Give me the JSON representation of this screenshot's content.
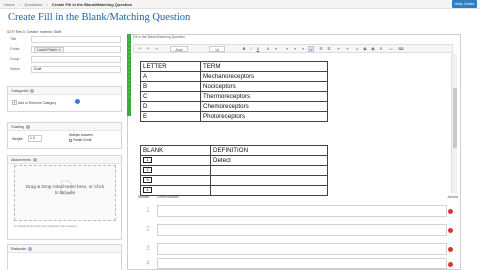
{
  "topbar": {
    "crumbs": [
      "Home",
      "Questions",
      "Create Fill in the Blank/Matching Question"
    ],
    "help_label": "Help Guide"
  },
  "page": {
    "title": "Create Fill in the Blank/Matching Question"
  },
  "meta": {
    "line": "ID 97 Rev 0, Creator: Inventor, Staff"
  },
  "fields": {
    "title_label": "Title",
    "folder_label": "Folder",
    "folder_value": "Lowell Folder",
    "group_label": "Group",
    "status_label": "Status",
    "status_value": "Draft"
  },
  "categories": {
    "header": "Categories",
    "add_label": "Add or Remove Category"
  },
  "grading": {
    "header": "Grading",
    "weight_label": "Weight",
    "weight_value": "1.0",
    "multi_label_1": "Multiple Answers",
    "multi_label_2": "Partial Credit"
  },
  "attachments": {
    "header": "Attachments",
    "drop_text": "Drag & Drop Attachment here, or Click to Browse",
    "note": "No attachments have been applied to this question."
  },
  "rationale": {
    "header": "Rationale"
  },
  "editor": {
    "title": "Fill in the Blank/Matching Question",
    "font_select": "Arial",
    "size_select": "14",
    "bold": "B",
    "italic": "I",
    "underline": "U"
  },
  "match_table": {
    "header": [
      "LETTER",
      "TERM"
    ],
    "rows": [
      [
        "A",
        "Mechanoreceptors"
      ],
      [
        "B",
        "Nociceptors"
      ],
      [
        "C",
        "Thermoreceptors"
      ],
      [
        "D",
        "Chemoreceptors"
      ],
      [
        "E",
        "Photoreceptors"
      ]
    ]
  },
  "blank_table": {
    "header": [
      "BLANK",
      "DEFINITION"
    ],
    "rows": [
      [
        "1",
        "Detect"
      ],
      [
        "2",
        ""
      ],
      [
        "3",
        ""
      ],
      [
        "4",
        ""
      ]
    ]
  },
  "answers": {
    "header_number": "Number",
    "header_answer": "Correct Answer",
    "header_actions": "Actions",
    "rows": [
      "1",
      "2",
      "3",
      "4"
    ]
  }
}
